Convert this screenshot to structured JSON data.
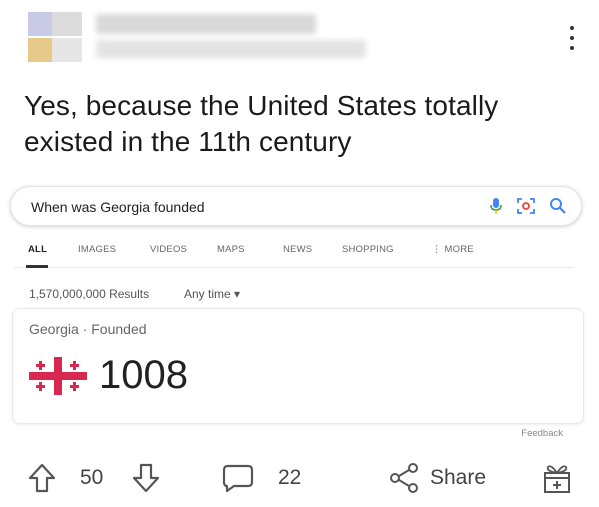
{
  "post": {
    "title": "Yes, because the United States totally existed in the 11th century"
  },
  "search": {
    "query": "When was Georgia founded"
  },
  "tabs": [
    {
      "label": "ALL",
      "active": true
    },
    {
      "label": "IMAGES"
    },
    {
      "label": "VIDEOS"
    },
    {
      "label": "MAPS"
    },
    {
      "label": "NEWS"
    },
    {
      "label": "SHOPPING"
    },
    {
      "label": "⋮ MORE"
    }
  ],
  "results": {
    "count": "1,570,000,000 Results",
    "filter": "Any time ▾"
  },
  "answer": {
    "label": "Georgia · Founded",
    "value": "1008",
    "feedback": "Feedback",
    "flag_colors": {
      "background": "#ffffff",
      "cross": "#d8284f"
    }
  },
  "actions": {
    "upvotes": "50",
    "comments": "22",
    "share_label": "Share"
  },
  "icons": [
    "kebab-menu-icon",
    "microphone-icon",
    "camera-scan-icon",
    "search-icon",
    "upvote-icon",
    "downvote-icon",
    "comment-icon",
    "share-icon",
    "gift-icon"
  ]
}
